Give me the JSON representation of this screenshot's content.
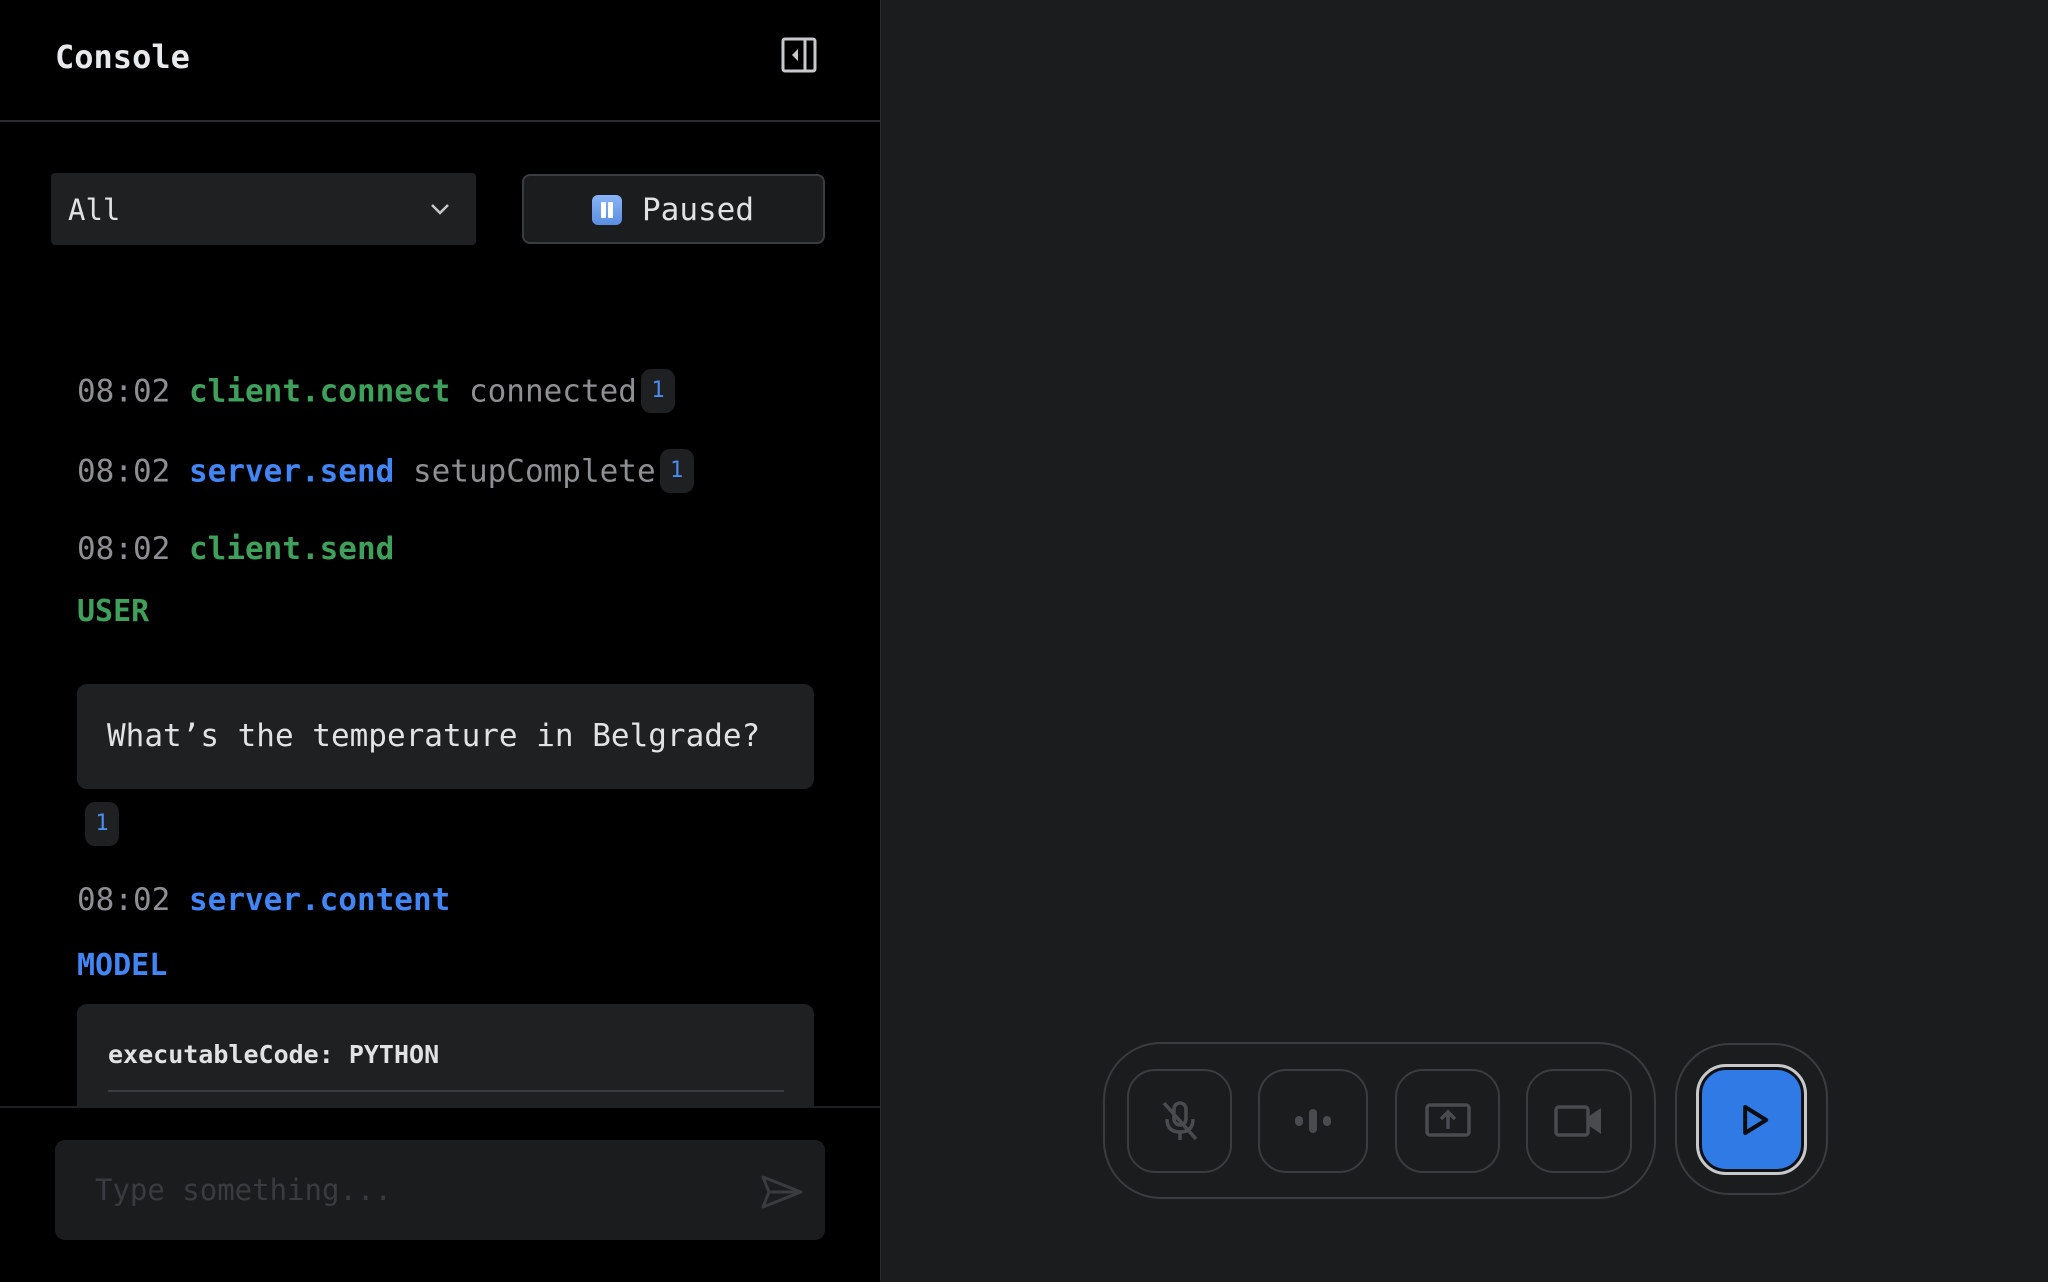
{
  "console": {
    "title": "Console",
    "filter": {
      "selected": "All"
    },
    "pause_label": "Paused",
    "logs": [
      {
        "time": "08:02",
        "source": "client.connect",
        "source_kind": "client",
        "message": "connected",
        "count": "1"
      },
      {
        "time": "08:02",
        "source": "server.send",
        "source_kind": "server",
        "message": "setupComplete",
        "count": "1"
      },
      {
        "time": "08:02",
        "source": "client.send",
        "source_kind": "client",
        "role": "USER",
        "text": "What’s the temperature in Belgrade?",
        "count": "1"
      },
      {
        "time": "08:02",
        "source": "server.content",
        "source_kind": "server",
        "role": "MODEL",
        "code_header": "executableCode: PYTHON"
      }
    ],
    "input": {
      "placeholder": "Type something..."
    }
  },
  "controls": {
    "icons": [
      "mic-off-icon",
      "audio-pulse-icon",
      "screen-share-icon",
      "video-camera-icon",
      "play-icon"
    ]
  },
  "colors": {
    "client": "#3ea05b",
    "server": "#4285f4",
    "accent": "#2f7ae5",
    "panel_bg": "#000000",
    "stage_bg": "#1b1c1e"
  }
}
